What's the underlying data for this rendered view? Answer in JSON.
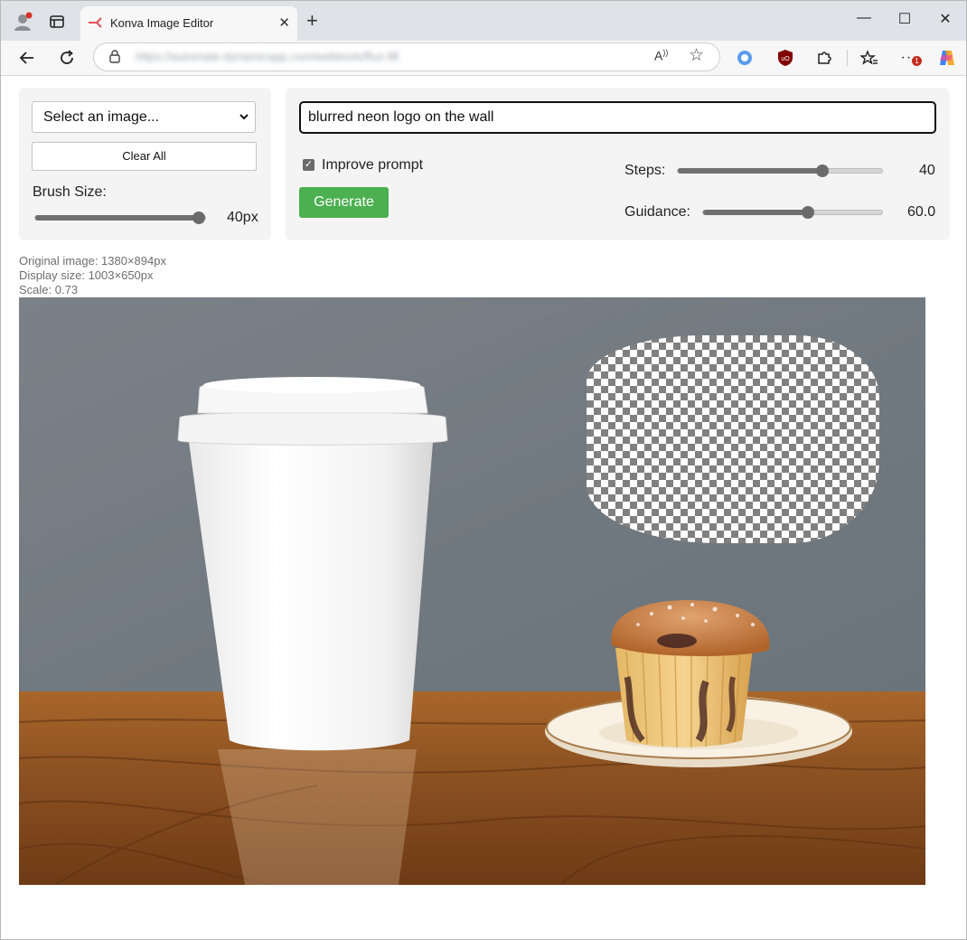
{
  "browser": {
    "tab_title": "Konva Image Editor",
    "address_url": "https://automate-dynamicapp.com/webtools/flux-fill",
    "icons": [
      "profile-icon",
      "workspaces-icon",
      "konva-favicon",
      "close-icon",
      "plus-icon",
      "minimize-icon",
      "maximize-icon",
      "window-close-icon",
      "back-arrow-icon",
      "refresh-icon",
      "lock-icon",
      "read-aloud-icon",
      "star-icon",
      "search-extension-icon",
      "ublock-icon",
      "extensions-puzzle-icon",
      "favorites-icon",
      "more-icon",
      "copilot-icon"
    ],
    "notification_count": "1"
  },
  "left_panel": {
    "select_placeholder": "Select an image...",
    "clear_button": "Clear All",
    "brush_label": "Brush Size:",
    "brush_value": "40px",
    "brush_slider_fraction": 0.95
  },
  "right_panel": {
    "prompt_value": "blurred neon logo on the wall",
    "improve_label": "Improve prompt",
    "improve_checked": true,
    "generate_button": "Generate",
    "steps_label": "Steps:",
    "steps_value": "40",
    "steps_slider_fraction": 0.7,
    "guidance_label": "Guidance:",
    "guidance_value": "60.0",
    "guidance_slider_fraction": 0.58
  },
  "info": {
    "original": "Original image: 1380×894px",
    "display": "Display size: 1003×650px",
    "scale": "Scale: 0.73"
  },
  "colors": {
    "generate_green": "#4caf50",
    "panel_bg": "#f4f4f4",
    "wall": "#737b82",
    "wood": "#8a4f1e"
  }
}
